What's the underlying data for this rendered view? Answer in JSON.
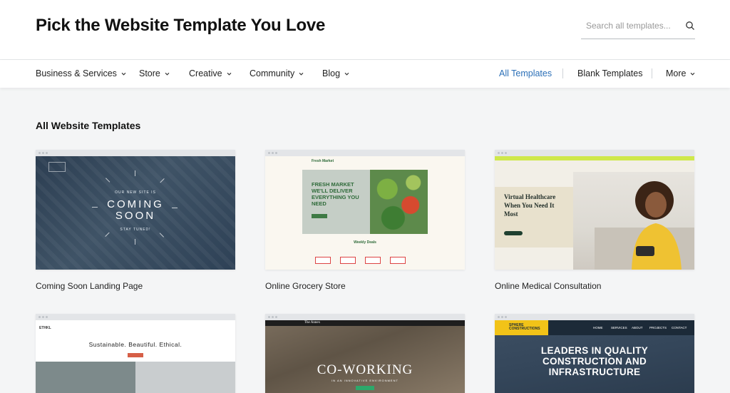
{
  "header": {
    "title": "Pick the Website Template You Love",
    "search_placeholder": "Search all templates..."
  },
  "nav": {
    "categories": [
      "Business & Services",
      "Store",
      "Creative",
      "Community",
      "Blog"
    ],
    "right": {
      "all_templates": "All Templates",
      "blank_templates": "Blank Templates",
      "more": "More"
    },
    "colors": {
      "active": "#2b6fb7"
    }
  },
  "section": {
    "title": "All Website Templates"
  },
  "templates": [
    {
      "title": "Coming Soon Landing Page",
      "preview": {
        "headline_small": "OUR NEW SITE IS",
        "headline": "COMING SOON",
        "tagline": "STAY TUNED!"
      }
    },
    {
      "title": "Online Grocery Store",
      "preview": {
        "brand": "Fresh Market",
        "headline": "FRESH MARKET WE'LL DELIVER EVERYTHING YOU NEED",
        "section": "Weekly Deals"
      }
    },
    {
      "title": "Online Medical Consultation",
      "preview": {
        "headline": "Virtual Healthcare When You Need It Most"
      }
    },
    {
      "title": "",
      "preview": {
        "brand": "ETHKL",
        "headline": "Sustainable. Beautiful. Ethical."
      }
    },
    {
      "title": "",
      "preview": {
        "brand": "The Annex",
        "headline": "CO-WORKING",
        "tagline": "IN AN INNOVATIVE ENVIRONMENT"
      }
    },
    {
      "title": "",
      "preview": {
        "brand": "SPHERE CONSTRUCTIONS",
        "nav_links": [
          "HOME",
          "SERVICES",
          "ABOUT",
          "PROJECTS",
          "CONTACT"
        ],
        "headline": "LEADERS IN QUALITY CONSTRUCTION AND INFRASTRUCTURE"
      }
    }
  ]
}
